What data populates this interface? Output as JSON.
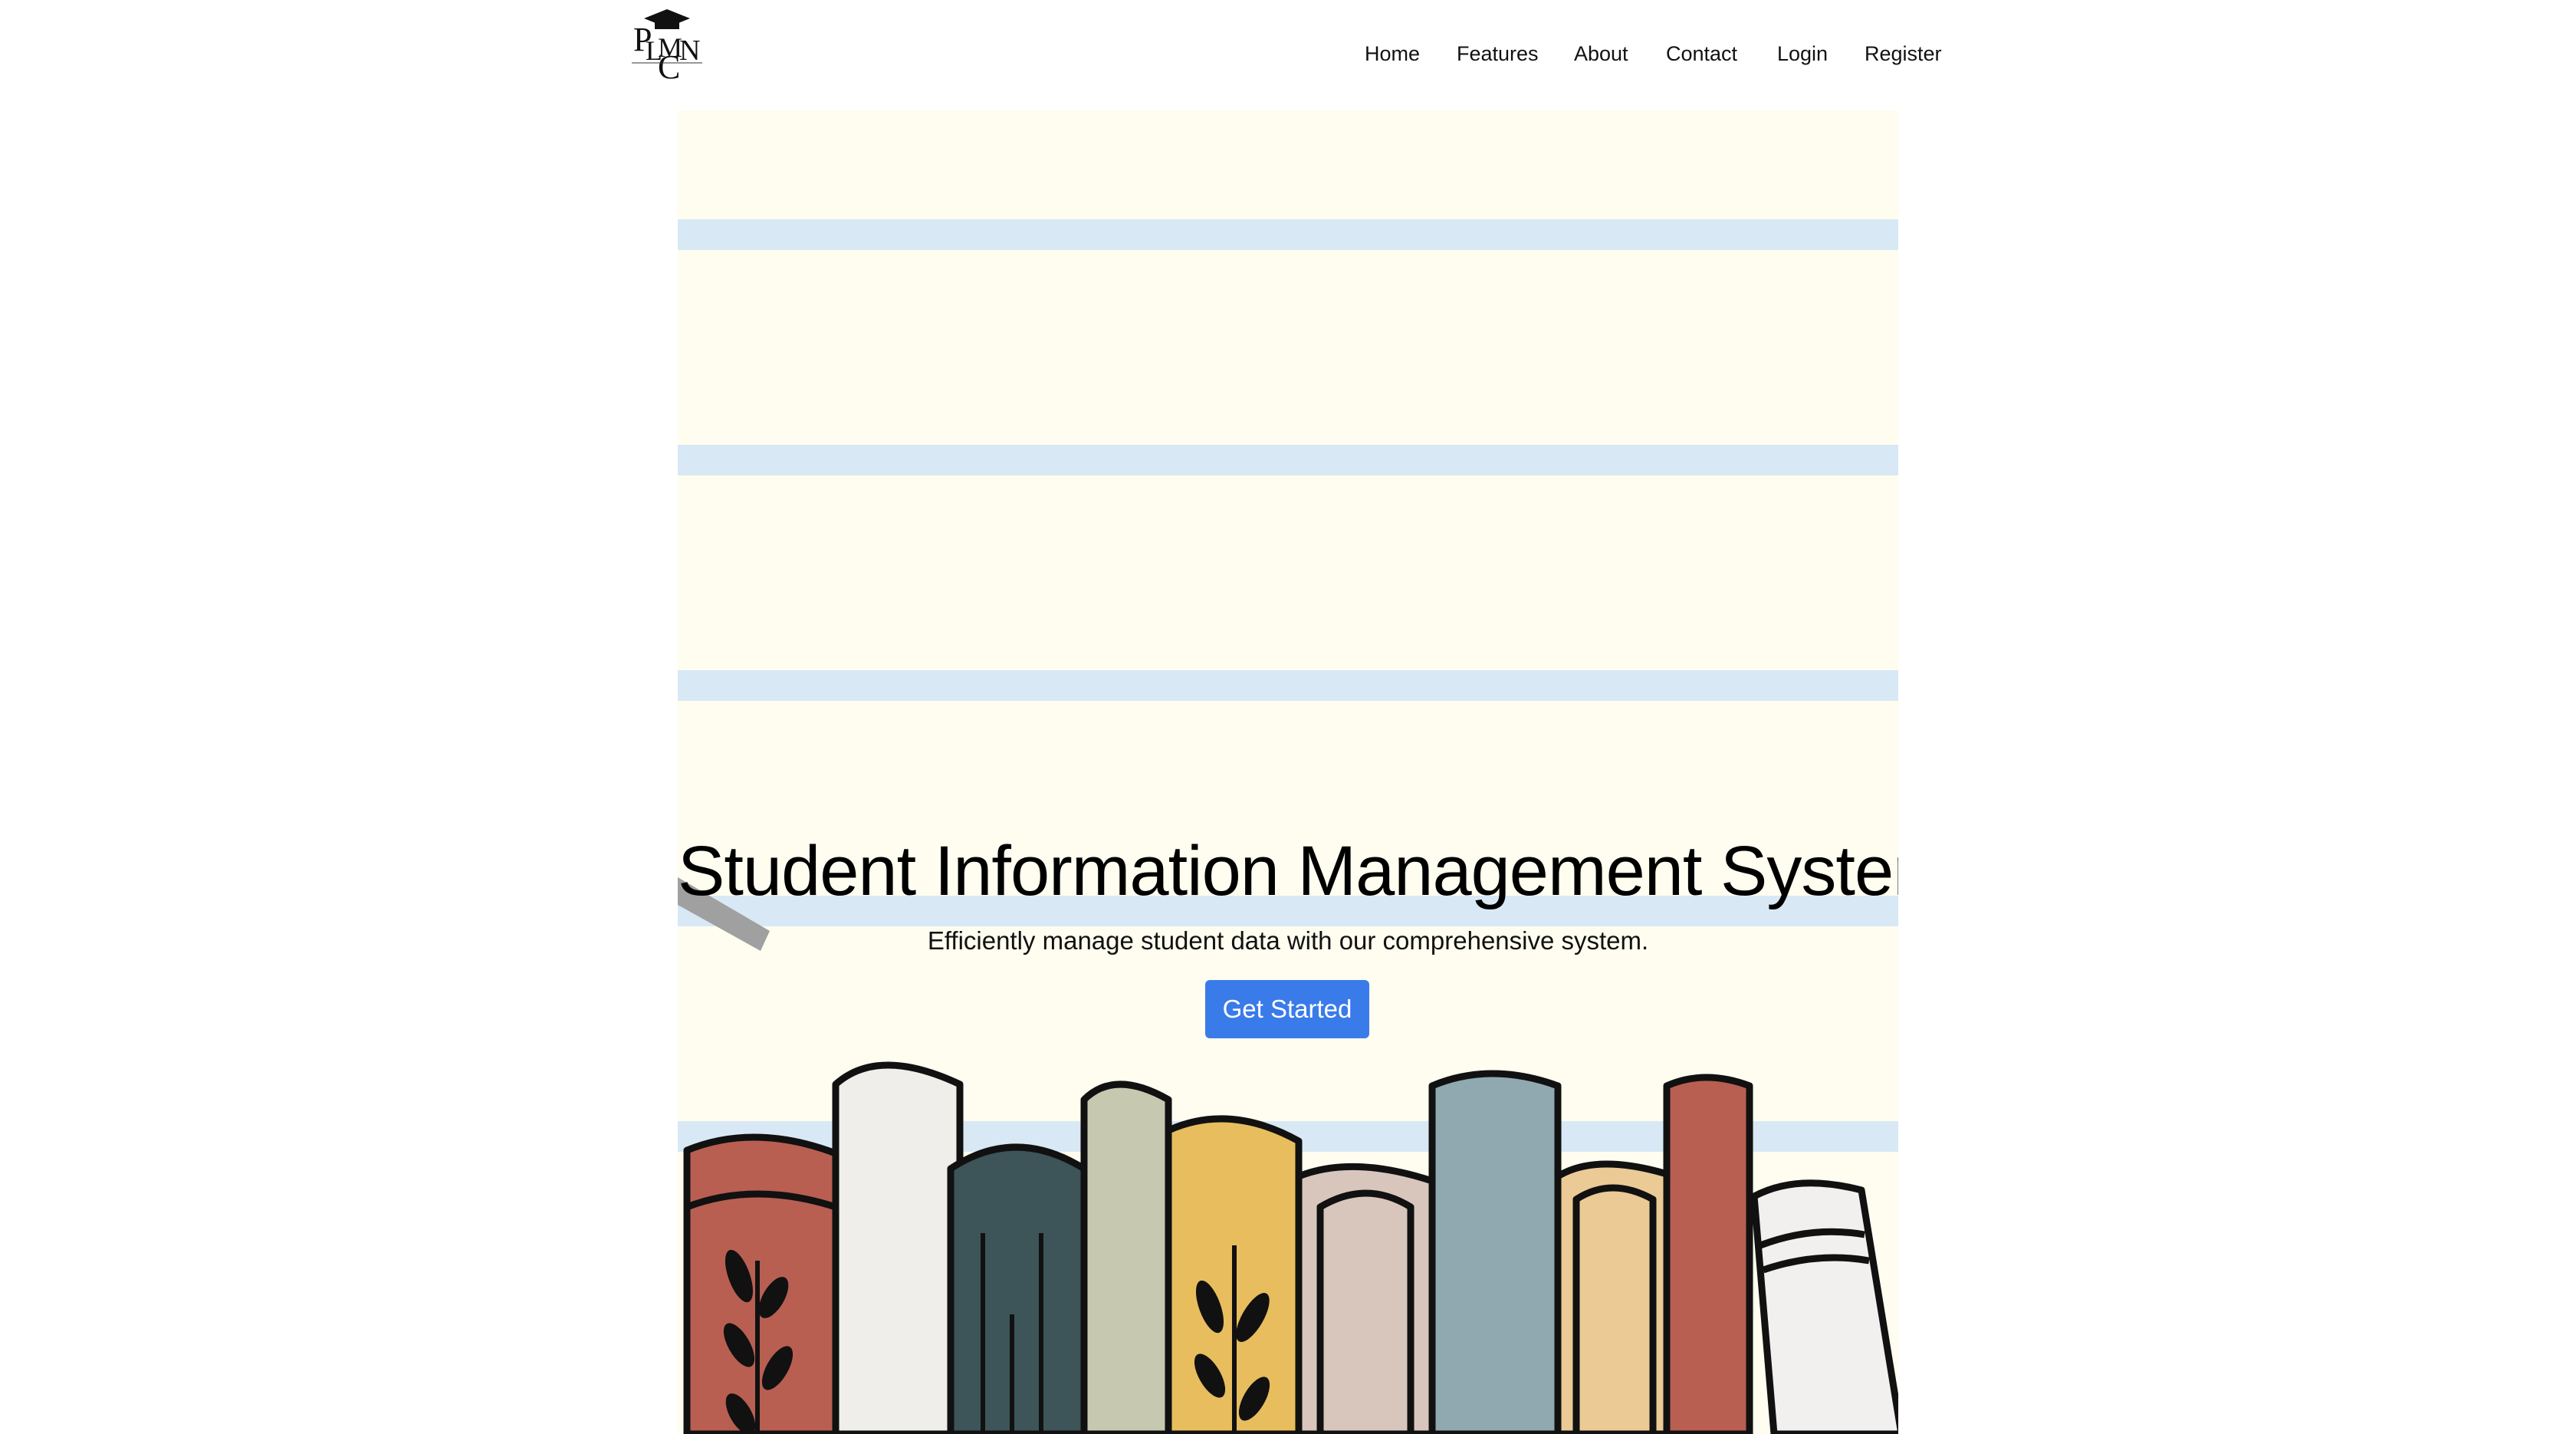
{
  "navbar": {
    "logo_text": "PLMN",
    "links": [
      {
        "label": "Home"
      },
      {
        "label": "Features"
      },
      {
        "label": "About"
      },
      {
        "label": "Contact"
      },
      {
        "label": "Login"
      },
      {
        "label": "Register"
      }
    ]
  },
  "hero": {
    "title": "Student Information Management System",
    "subtitle": "Efficiently manage student data with our comprehensive system.",
    "cta_label": "Get Started",
    "background_color": "#fefdf0",
    "stripe_color": "#d8e9f5",
    "button_color": "#3a7bea",
    "book_colors": [
      "#b85f52",
      "#efeeeb",
      "#3d5559",
      "#c7c8b0",
      "#e8bd5e",
      "#d8c6bd",
      "#90a9b0",
      "#ebca96",
      "#b85f52",
      "#f1f0ee"
    ]
  }
}
